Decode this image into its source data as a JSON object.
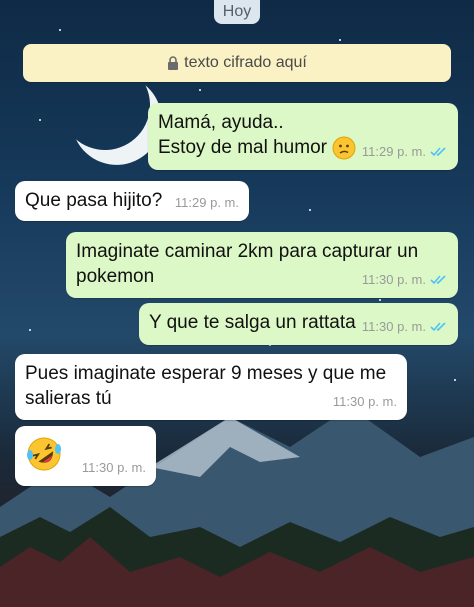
{
  "date_chip": "Hoy",
  "encryption_banner": {
    "text": "texto cifrado aquí",
    "icon": "lock-icon"
  },
  "colors": {
    "outgoing": "#dcf8c6",
    "incoming": "#ffffff",
    "read_ticks": "#4fc3f7",
    "banner": "#faf1c4"
  },
  "messages": [
    {
      "direction": "out",
      "lines": [
        "Mamá, ayuda..",
        "Estoy de mal humor"
      ],
      "emoji": "confused-face",
      "time": "11:29 p. m.",
      "status": "read"
    },
    {
      "direction": "in",
      "lines": [
        "Que pasa hijito?"
      ],
      "time": "11:29 p. m."
    },
    {
      "direction": "out",
      "lines": [
        "Imaginate caminar 2km para capturar un",
        "pokemon"
      ],
      "time": "11:30 p. m.",
      "status": "read"
    },
    {
      "direction": "out",
      "lines": [
        "Y que te salga un rattata"
      ],
      "time": "11:30 p. m.",
      "status": "read"
    },
    {
      "direction": "in",
      "lines": [
        "Pues imaginate esperar 9 meses y que me",
        "salieras tú"
      ],
      "time": "11:30 p. m."
    },
    {
      "direction": "in",
      "lines": [],
      "emoji": "rolling-on-floor-laughing",
      "time": "11:30 p. m."
    }
  ]
}
